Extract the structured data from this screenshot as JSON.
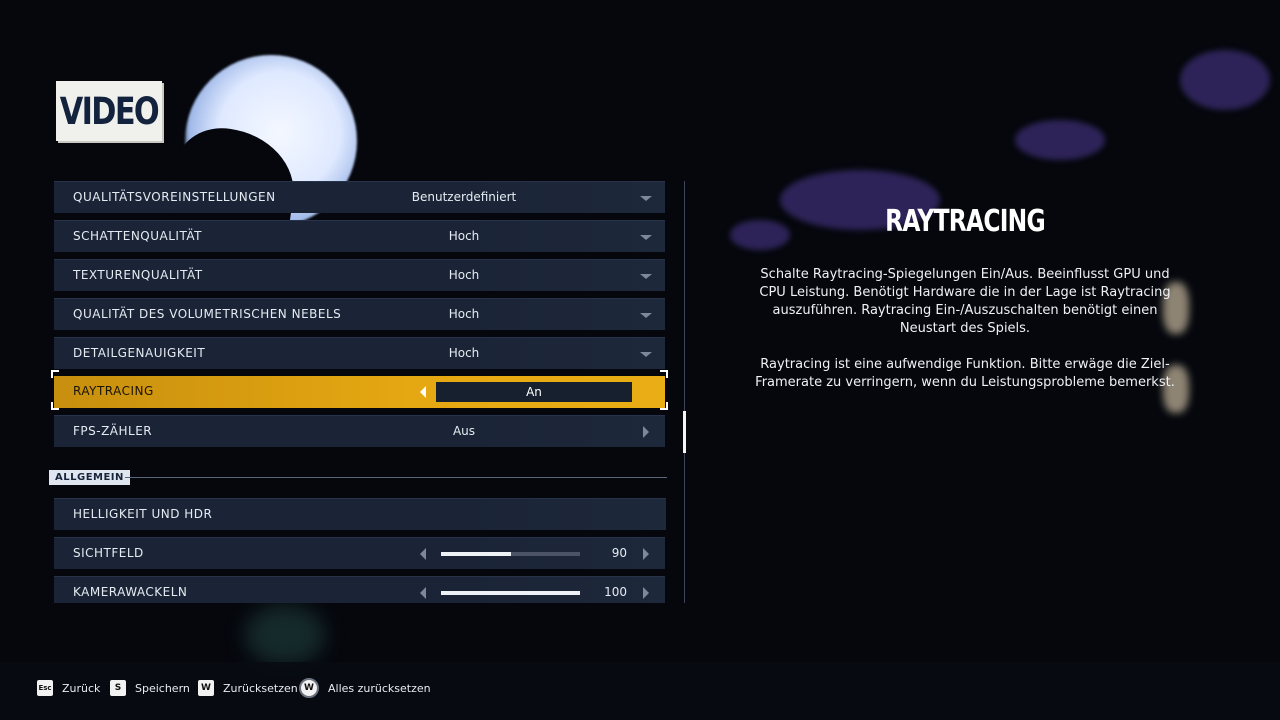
{
  "page": {
    "title": "VIDEO"
  },
  "settings": [
    {
      "label": "QUALITÄTSVOREINSTELLUNGEN",
      "value": "Benutzerdefiniert",
      "control": "dropdown"
    },
    {
      "label": "SCHATTENQUALITÄT",
      "value": "Hoch",
      "control": "dropdown"
    },
    {
      "label": "TEXTURENQUALITÄT",
      "value": "Hoch",
      "control": "dropdown"
    },
    {
      "label": "QUALITÄT DES VOLUMETRISCHEN NEBELS",
      "value": "Hoch",
      "control": "dropdown"
    },
    {
      "label": "DETAILGENAUIGKEIT",
      "value": "Hoch",
      "control": "dropdown"
    },
    {
      "label": "RAYTRACING",
      "value": "An",
      "control": "toggle",
      "selected": true
    },
    {
      "label": "FPS-ZÄHLER",
      "value": "Aus",
      "control": "toggle"
    }
  ],
  "section": {
    "label": "ALLGEMEIN"
  },
  "general": [
    {
      "label": "HELLIGKEIT UND HDR"
    },
    {
      "label": "SICHTFELD",
      "value": "90",
      "fill": 0.5
    },
    {
      "label": "KAMERAWACKELN",
      "value": "100",
      "fill": 1.0
    }
  ],
  "info": {
    "title": "RAYTRACING",
    "paragraph1": "Schalte Raytracing-Spiegelungen Ein/Aus. Beeinflusst GPU und CPU Leistung. Benötigt Hardware die in der Lage ist Raytracing auszuführen. Raytracing Ein-/Auszuschalten benötigt einen Neustart des Spiels.",
    "paragraph2": "Raytracing ist eine aufwendige Funktion. Bitte erwäge die Ziel-Framerate zu verringern, wenn du Leistungsprobleme bemerkst."
  },
  "hints": [
    {
      "key": "Esc",
      "label": "Zurück"
    },
    {
      "key": "S",
      "label": "Speichern"
    },
    {
      "key": "W",
      "label": "Zurücksetzen"
    },
    {
      "key": "W",
      "label": "Alles zurücksetzen"
    }
  ],
  "colors": {
    "accent": "#e6a812",
    "row": "#1a2436",
    "background": "#05070d"
  }
}
